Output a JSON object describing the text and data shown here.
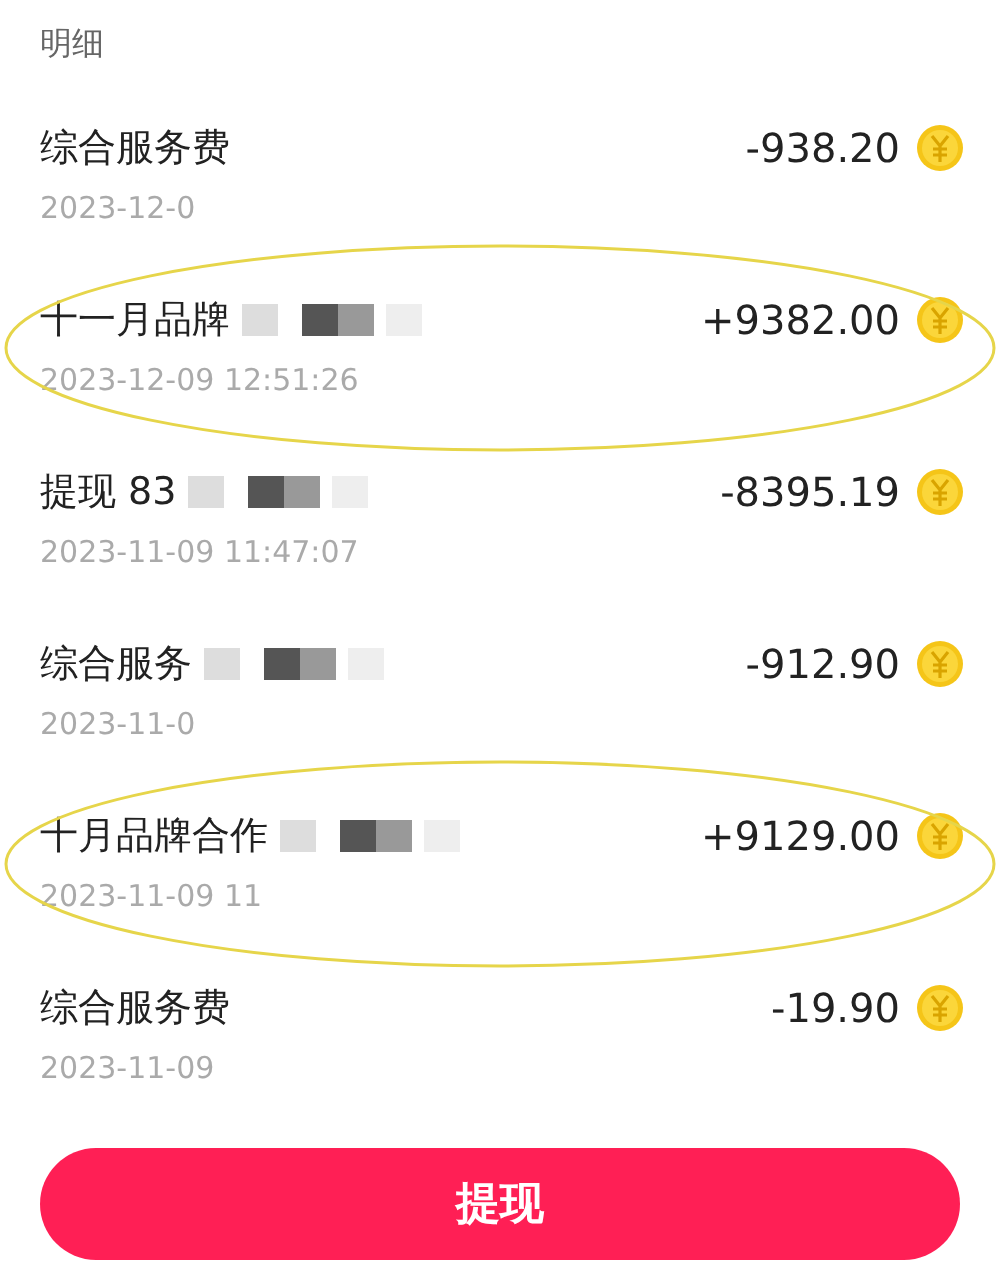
{
  "section_title": "明细",
  "transactions": [
    {
      "title": "综合服务费",
      "date": "2023-12-0",
      "amount": "-938.20",
      "redacted": false,
      "highlighted": false
    },
    {
      "title": "十一月品牌",
      "date": "2023-12-09 12:51:26",
      "amount": "+9382.00",
      "redacted": true,
      "highlighted": true
    },
    {
      "title": "提现 83",
      "date": "2023-11-09 11:47:07",
      "amount": "-8395.19",
      "redacted": true,
      "highlighted": false
    },
    {
      "title": "综合服务",
      "date": "2023-11-0",
      "amount": "-912.90",
      "redacted": true,
      "highlighted": false
    },
    {
      "title": "十月品牌合作",
      "date": "2023-11-09 11",
      "amount": "+9129.00",
      "redacted": true,
      "highlighted": true
    },
    {
      "title": "综合服务费",
      "date": "2023-11-09",
      "amount": "-19.90",
      "redacted": false,
      "highlighted": false
    }
  ],
  "withdraw_button": "提现"
}
